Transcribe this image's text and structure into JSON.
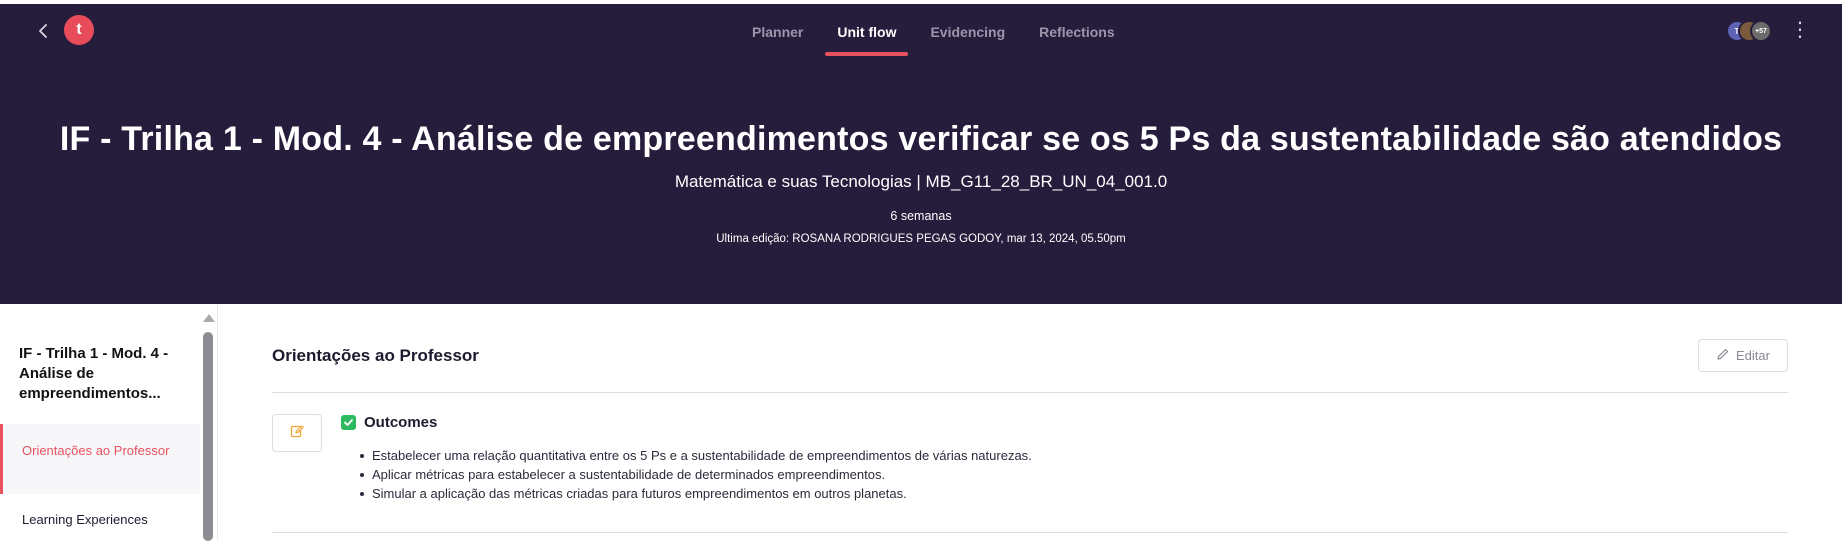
{
  "nav": {
    "tabs": [
      {
        "label": "Planner",
        "active": false
      },
      {
        "label": "Unit flow",
        "active": true
      },
      {
        "label": "Evidencing",
        "active": false
      },
      {
        "label": "Reflections",
        "active": false
      }
    ],
    "logo_letter": "t",
    "avatars": [
      "T",
      "",
      "+57"
    ]
  },
  "unit": {
    "title": "IF - Trilha 1 - Mod. 4 - Análise de empreendimentos verificar se os 5 Ps da sustentabilidade são atendidos",
    "subtitle": "Matemática e suas Tecnologias | MB_G11_28_BR_UN_04_001.0",
    "duration": "6 semanas",
    "last_edit": "Ultima edição: ROSANA RODRIGUES PEGAS GODOY, mar 13, 2024, 05.50pm"
  },
  "sidebar": {
    "title": "IF - Trilha 1 - Mod. 4 - Análise de empreendimentos...",
    "items": [
      {
        "label": "Orientações ao Professor",
        "active": true
      },
      {
        "label": "Learning Experiences",
        "active": false
      }
    ]
  },
  "main": {
    "section_title": "Orientações ao Professor",
    "edit_label": "Editar",
    "outcomes_label": "Outcomes",
    "outcomes": [
      "Estabelecer uma relação quantitativa entre os 5 Ps e a sustentabilidade de empreendimentos de várias naturezas.",
      "Aplicar métricas para estabelecer a sustentabilidade de determinados empreendimentos.",
      "Simular a aplicação das métricas criadas para futuros empreendimentos em outros planetas."
    ]
  },
  "colors": {
    "header_bg": "#261c3b",
    "accent": "#e8525f",
    "check": "#2cb95f"
  }
}
